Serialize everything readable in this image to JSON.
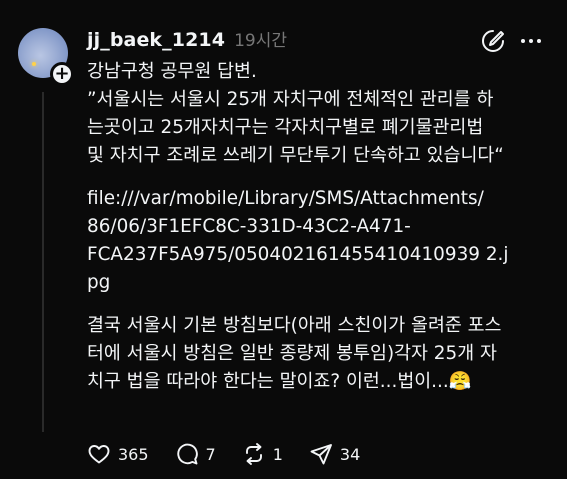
{
  "post": {
    "username": "jj_baek_1214",
    "timestamp": "19시간",
    "paragraphs": [
      {
        "lines": [
          "강남구청 공무원 답변.",
          "”서울시는 서울시 25개 자치구에 전체적인 관리를 하",
          "는곳이고  25개자치구는  각자치구별로 폐기물관리법",
          "및 자치구 조례로 쓰레기 무단투기 단속하고 있습니다“"
        ]
      },
      {
        "lines": [
          "file:///var/mobile/Library/SMS/Attachments/",
          "86/06/3F1EFC8C-331D-43C2-A471-",
          "FCA237F5A975/050402161455410410939 2.j",
          "pg"
        ]
      },
      {
        "lines": [
          "결국 서울시 기본 방침보다(아래 스친이가 올려준 포스",
          "터에 서울시 방침은 일반 종량제 봉투임)각자 25개 자",
          "치구 법을 따라야 한다는 말이죠? 이런...법이...😤"
        ]
      }
    ]
  },
  "actions": {
    "like": {
      "icon": "heart-icon",
      "count": "365"
    },
    "comment": {
      "icon": "comment-icon",
      "count": "7"
    },
    "repost": {
      "icon": "repost-icon",
      "count": "1"
    },
    "share": {
      "icon": "send-icon",
      "count": "34"
    }
  }
}
